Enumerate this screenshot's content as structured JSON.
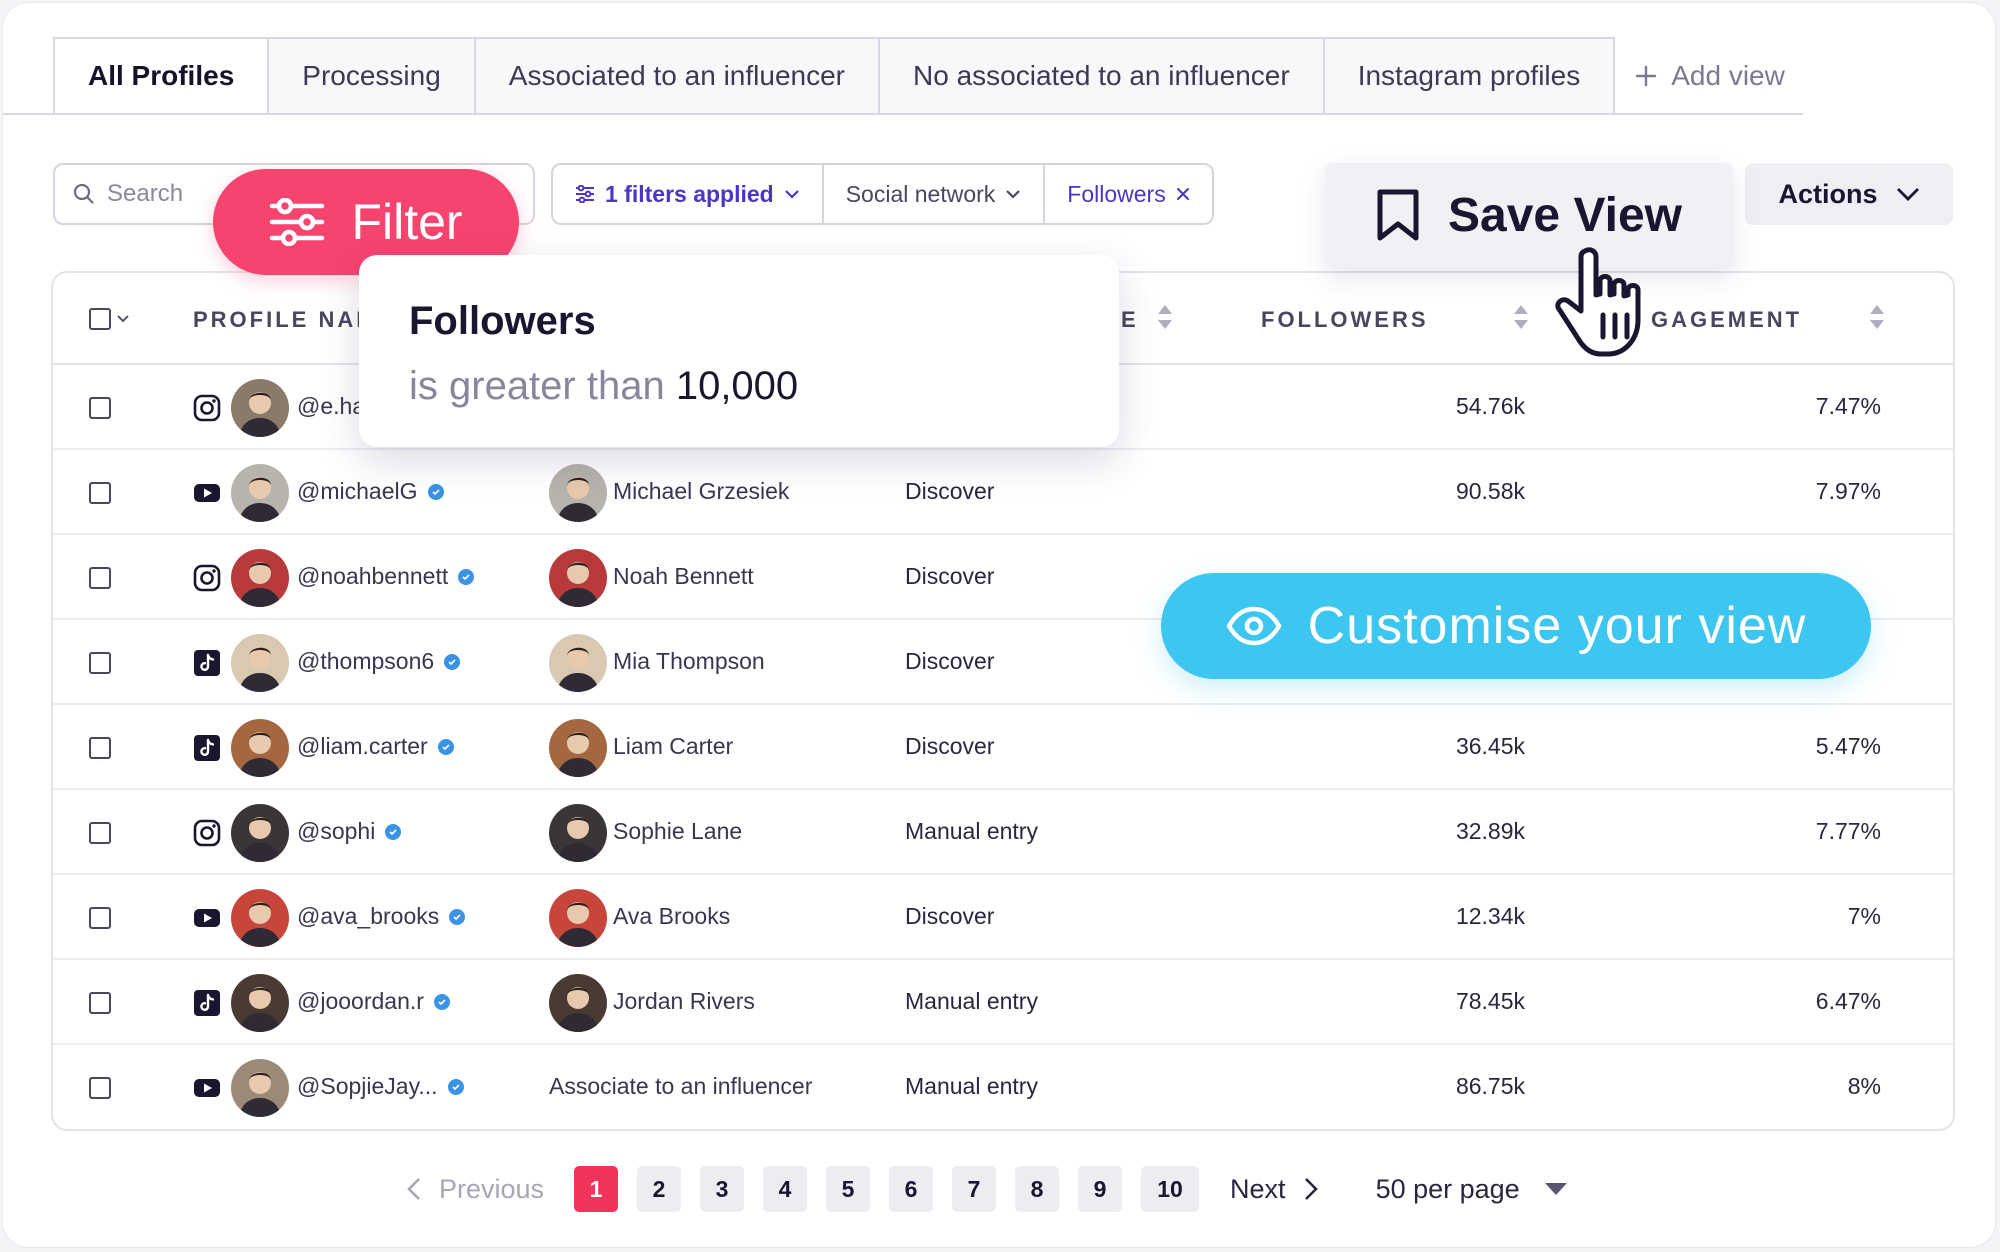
{
  "tabs": [
    "All Profiles",
    "Processing",
    "Associated to an influencer",
    "No associated to an influencer",
    "Instagram profiles"
  ],
  "add_view_label": "Add view",
  "search": {
    "placeholder": "Search"
  },
  "filter_pill": "Filter",
  "filter_bar": {
    "applied": "1 filters applied",
    "social": "Social network",
    "followers": "Followers"
  },
  "save_view_label": "Save View",
  "actions_label": "Actions",
  "columns": {
    "profile": "PROFILE NAM",
    "source_partial": "E",
    "followers": "FOLLOWERS",
    "engagement": "GAGEMENT"
  },
  "popover": {
    "title": "Followers",
    "condition": "is greater than ",
    "value": "10,000"
  },
  "banner": "Customise your view",
  "rows": [
    {
      "network": "instagram-icon",
      "handle": "@e.ha",
      "influencer": "",
      "source": "",
      "followers": "54.76k",
      "engagement": "7.47%"
    },
    {
      "network": "youtube-icon",
      "handle": "@michaelG",
      "influencer": "Michael Grzesiek",
      "source": "Discover",
      "followers": "90.58k",
      "engagement": "7.97%"
    },
    {
      "network": "instagram-icon",
      "handle": "@noahbennett",
      "influencer": "Noah Bennett",
      "source": "Discover",
      "followers": "",
      "engagement": ""
    },
    {
      "network": "tiktok-icon",
      "handle": "@thompson6",
      "influencer": "Mia Thompson",
      "source": "Discover",
      "followers": "",
      "engagement": ""
    },
    {
      "network": "tiktok-icon",
      "handle": "@liam.carter",
      "influencer": "Liam Carter",
      "source": "Discover",
      "followers": "36.45k",
      "engagement": "5.47%"
    },
    {
      "network": "instagram-icon",
      "handle": "@sophi",
      "influencer": "Sophie Lane",
      "source": "Manual entry",
      "followers": "32.89k",
      "engagement": "7.77%"
    },
    {
      "network": "youtube-icon",
      "handle": "@ava_brooks",
      "influencer": "Ava Brooks",
      "source": "Discover",
      "followers": "12.34k",
      "engagement": "7%"
    },
    {
      "network": "tiktok-icon",
      "handle": "@jooordan.r",
      "influencer": "Jordan Rivers",
      "source": "Manual entry",
      "followers": "78.45k",
      "engagement": "6.47%"
    },
    {
      "network": "youtube-icon",
      "handle": "@SopjieJay...",
      "influencer": "Associate to an influencer",
      "source": "Manual entry",
      "followers": "86.75k",
      "engagement": "8%"
    }
  ],
  "pagination": {
    "previous": "Previous",
    "pages": [
      "1",
      "2",
      "3",
      "4",
      "5",
      "6",
      "7",
      "8",
      "9",
      "10"
    ],
    "current": "1",
    "next": "Next",
    "per_page": "50 per page"
  },
  "colors": {
    "accent": "#4a35c4",
    "filter_pill": "#f6446e",
    "banner": "#3cc6f0",
    "active_page": "#f0335a",
    "verified": "#3b93e6"
  }
}
